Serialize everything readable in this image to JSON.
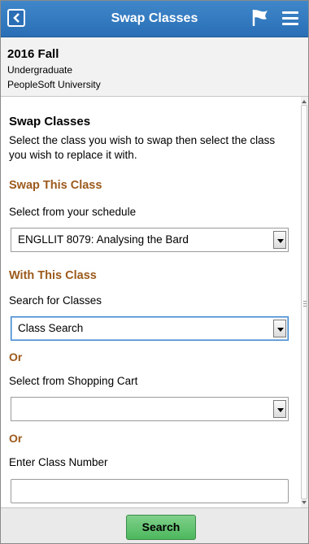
{
  "header": {
    "title": "Swap Classes"
  },
  "context": {
    "term": "2016 Fall",
    "career": "Undergraduate",
    "institution": "PeopleSoft University"
  },
  "main": {
    "heading": "Swap Classes",
    "instructions": "Select the class you wish to swap then select the class you wish to replace it with.",
    "swap_section_title": "Swap This Class",
    "schedule_label": "Select from your schedule",
    "schedule_value": "ENGLLIT 8079: Analysing the Bard",
    "with_section_title": "With This Class",
    "search_label": "Search for Classes",
    "search_value": "Class Search",
    "or_1": "Or",
    "cart_label": "Select from Shopping Cart",
    "cart_value": "",
    "or_2": "Or",
    "class_number_label": "Enter Class Number",
    "class_number_value": ""
  },
  "footer": {
    "search_label": "Search"
  },
  "colors": {
    "header_blue": "#2a6fb6",
    "section_brown": "#9c5a1c",
    "search_green": "#4cb85d"
  }
}
